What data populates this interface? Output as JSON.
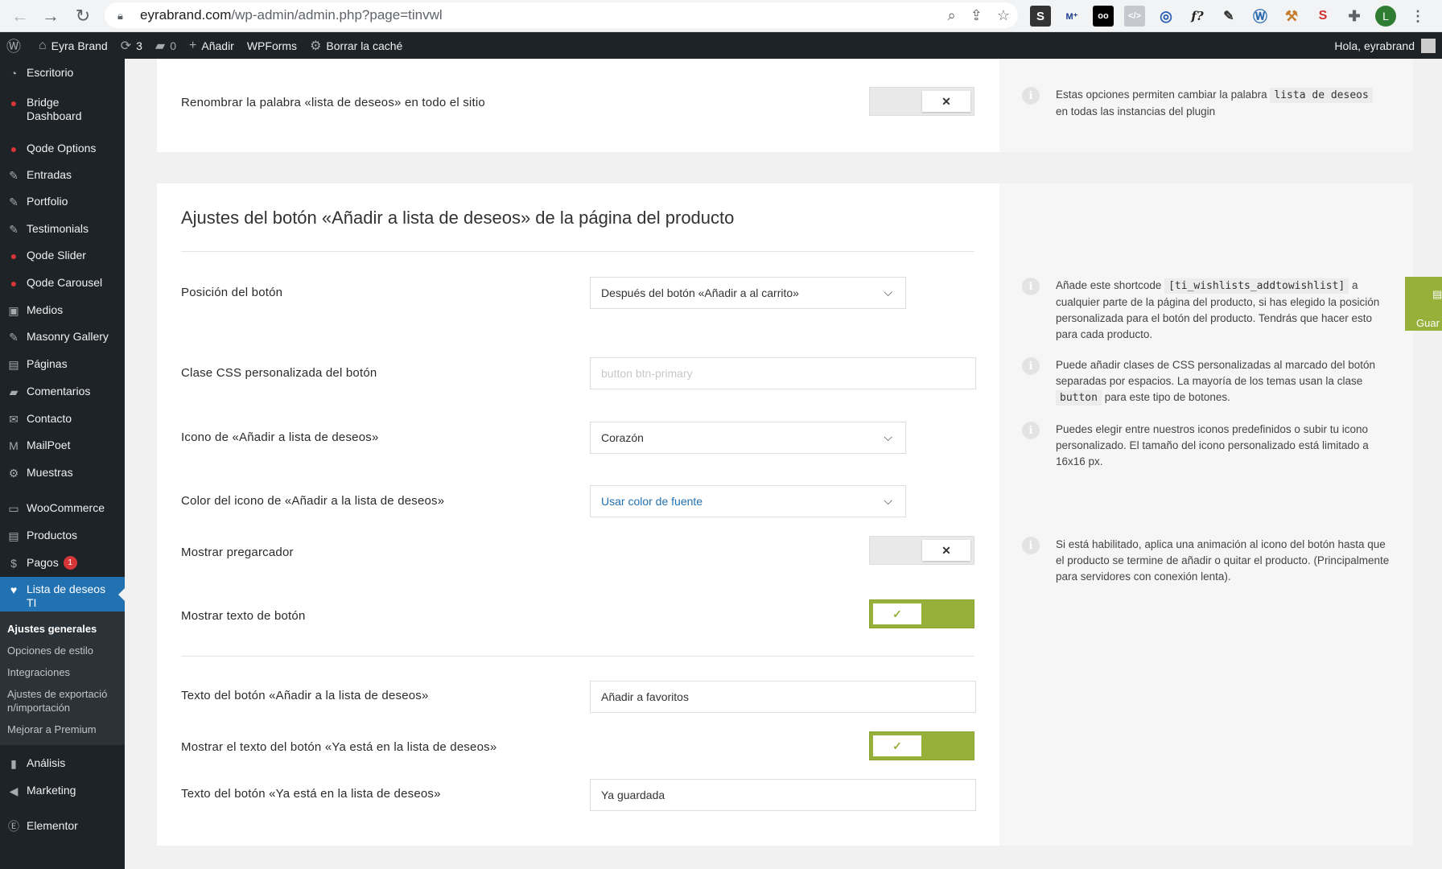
{
  "browser": {
    "url_host": "eyrabrand.com",
    "url_path": "/wp-admin/admin.php?page=tinvwl",
    "avatar_letter": "L"
  },
  "adminbar": {
    "site_name": "Eyra Brand",
    "updates_count": "3",
    "comments_count": "0",
    "add_label": "Añadir",
    "wpforms_label": "WPForms",
    "cache_label": "Borrar la caché",
    "greeting": "Hola, eyrabrand"
  },
  "sidebar": {
    "items": [
      {
        "label": "Escritorio"
      },
      {
        "label": "Bridge Dashboard"
      },
      {
        "label": "Qode Options"
      },
      {
        "label": "Entradas"
      },
      {
        "label": "Portfolio"
      },
      {
        "label": "Testimonials"
      },
      {
        "label": "Qode Slider"
      },
      {
        "label": "Qode Carousel"
      },
      {
        "label": "Medios"
      },
      {
        "label": "Masonry Gallery"
      },
      {
        "label": "Páginas"
      },
      {
        "label": "Comentarios"
      },
      {
        "label": "Contacto"
      },
      {
        "label": "MailPoet"
      },
      {
        "label": "Muestras"
      },
      {
        "label": "WooCommerce"
      },
      {
        "label": "Productos"
      },
      {
        "label": "Pagos",
        "badge": "1"
      },
      {
        "label": "Lista de deseos TI"
      },
      {
        "label": "Análisis"
      },
      {
        "label": "Marketing"
      },
      {
        "label": "Elementor"
      }
    ],
    "submenu": [
      {
        "label": "Ajustes generales"
      },
      {
        "label": "Opciones de estilo"
      },
      {
        "label": "Integraciones"
      },
      {
        "label": "Ajustes de exportación/importación"
      },
      {
        "label": "Mejorar a Premium"
      }
    ]
  },
  "rename_section": {
    "label": "Renombrar la palabra «lista de deseos» en todo el sitio",
    "toggle_symbol": "✕",
    "help_before": "Estas opciones permiten cambiar la palabra",
    "help_code": "lista de deseos",
    "help_after": "en todas las instancias del plugin"
  },
  "product_section": {
    "title": "Ajustes del botón «Añadir a lista de deseos» de la página del producto",
    "position_label": "Posición del botón",
    "position_value": "Después del botón «Añadir a al carrito»",
    "css_label": "Clase CSS personalizada del botón",
    "css_placeholder": "button btn-primary",
    "icon_label": "Icono de «Añadir a lista de deseos»",
    "icon_value": "Corazón",
    "color_label": "Color del icono de «Añadir a la lista de deseos»",
    "color_value": "Usar color de fuente",
    "preloader_label": "Mostrar pregarcador",
    "preloader_symbol": "✕",
    "show_text_label": "Mostrar texto de botón",
    "show_text_symbol": "✓",
    "button_text_label": "Texto del botón «Añadir a la lista de deseos»",
    "button_text_value": "Añadir a favoritos",
    "show_already_label": "Mostrar el texto del botón «Ya está en la lista de deseos»",
    "show_already_symbol": "✓",
    "already_text_label": "Texto del botón «Ya está en la lista de deseos»",
    "already_text_value": "Ya guardada"
  },
  "help": {
    "shortcode_before": "Añade este shortcode",
    "shortcode_code": "[ti_wishlists_addtowishlist]",
    "shortcode_after": "a cualquier parte de la página del producto, si has elegido la posición personalizada para el botón del producto. Tendrás que hacer esto para cada producto.",
    "css_before": "Puede añadir clases de CSS personalizadas al marcado del botón separadas por espacios. La mayoría de los temas usan la clase",
    "css_code": "button",
    "css_after": "para este tipo de botones.",
    "icon_text": "Puedes elegir entre nuestros iconos predefinidos o subir tu icono personalizado. El tamaño del icono personalizado está limitado a 16x16 px.",
    "preloader_text": "Si está habilitado, aplica una animación al icono del botón hasta que el producto se termine de añadir o quitar el producto. (Principalmente para servidores con conexión lenta)."
  },
  "save_tab": {
    "label": "Guar"
  },
  "colors": {
    "accent_green": "#96b03a",
    "wp_blue": "#2271b1",
    "admin_dark": "#1d2327"
  }
}
